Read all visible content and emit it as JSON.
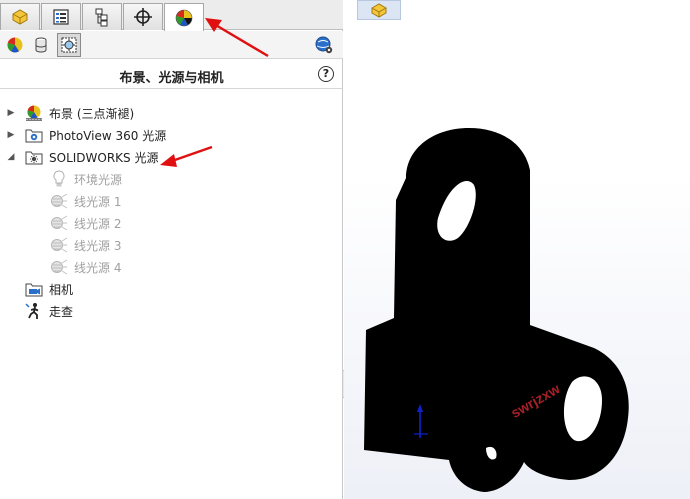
{
  "panel": {
    "title": "布景、光源与相机",
    "help_label": "?",
    "tabs": [
      {
        "name": "featuremanager",
        "icon": "part-tree-icon"
      },
      {
        "name": "propertymanager",
        "icon": "property-list-icon"
      },
      {
        "name": "configurationmanager",
        "icon": "configuration-icon"
      },
      {
        "name": "dimxpertmanager",
        "icon": "crosshair-icon"
      },
      {
        "name": "displaymanager",
        "icon": "appearance-ball-icon",
        "active": true
      }
    ],
    "subicons": [
      "appearance-icon",
      "decal-icon",
      "scene-lights-cameras-icon"
    ],
    "settings_icon": "display-settings-icon"
  },
  "tree": {
    "items": [
      {
        "label": "布景 (三点渐褪)",
        "expand": "▶",
        "icon": "scene-ball-icon"
      },
      {
        "label": "PhotoView 360 光源",
        "expand": "▶",
        "icon": "photoview-folder-icon"
      },
      {
        "label": "SOLIDWORKS 光源",
        "expand": "◢",
        "icon": "solidworks-lights-folder-icon"
      }
    ],
    "children": [
      {
        "label": "环境光源",
        "icon": "bulb-icon"
      },
      {
        "label": "线光源 1",
        "icon": "directional-light-icon"
      },
      {
        "label": "线光源 2",
        "icon": "directional-light-icon"
      },
      {
        "label": "线光源 3",
        "icon": "directional-light-icon"
      },
      {
        "label": "线光源 4",
        "icon": "directional-light-icon"
      }
    ],
    "bottom": [
      {
        "label": "相机",
        "icon": "camera-icon"
      },
      {
        "label": "走查",
        "icon": "walkthrough-icon"
      }
    ]
  },
  "viewport": {
    "watermark": "swrjzxw",
    "part_color": "#000000",
    "arrow_color": "#e01010"
  }
}
